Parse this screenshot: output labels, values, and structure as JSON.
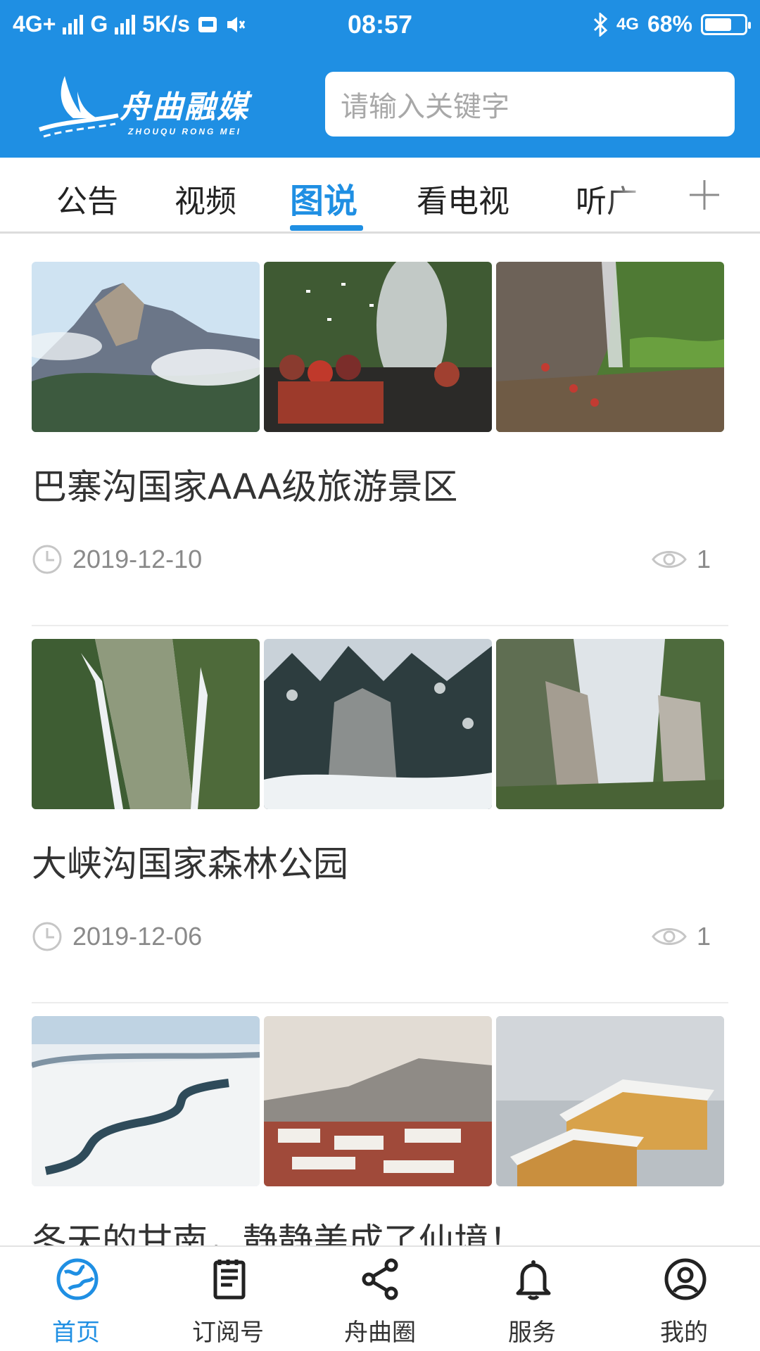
{
  "status_bar": {
    "network_left": "4G+",
    "carrier2": "G",
    "speed": "5K/s",
    "time": "08:57",
    "network_right": "4G",
    "battery": "68%",
    "battery_level": 0.68
  },
  "app": {
    "logo_text": "舟曲融媒",
    "logo_subtext": "ZHOUQU RONG MEI",
    "brand_color": "#1f8fe3"
  },
  "search": {
    "placeholder": "请输入关键字"
  },
  "tabs": [
    {
      "label": "公告"
    },
    {
      "label": "视频"
    },
    {
      "label": "图说",
      "active": true
    },
    {
      "label": "看电视"
    },
    {
      "label": "听广"
    }
  ],
  "feed": [
    {
      "title": "巴寨沟国家AAA级旅游景区",
      "date": "2019-12-10",
      "views": "1",
      "thumb_icons": [
        "mountain-photo",
        "festival-photo",
        "cliff-photo"
      ]
    },
    {
      "title": "大峡沟国家森林公园",
      "date": "2019-12-06",
      "views": "1",
      "thumb_icons": [
        "waterfall-photo",
        "snow-forest-photo",
        "gorge-photo"
      ]
    },
    {
      "title": "冬天的甘南，静静美成了仙境！",
      "date": "",
      "views": "",
      "thumb_icons": [
        "snow-river-photo",
        "monastery-photo",
        "snow-village-photo"
      ]
    }
  ],
  "bottom_nav": [
    {
      "label": "首页",
      "icon": "globe-icon",
      "active": true
    },
    {
      "label": "订阅号",
      "icon": "document-icon"
    },
    {
      "label": "舟曲圈",
      "icon": "share-icon"
    },
    {
      "label": "服务",
      "icon": "bell-icon"
    },
    {
      "label": "我的",
      "icon": "user-icon"
    }
  ]
}
